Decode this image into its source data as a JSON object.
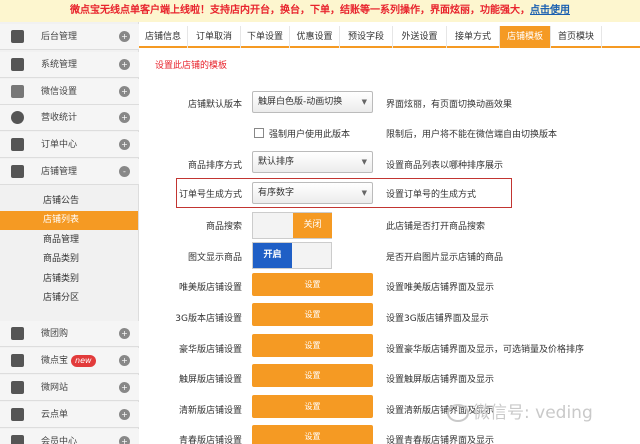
{
  "banner": {
    "text": "微点宝无线点单客户端上线啦！支持店内开台，换台，下单，结账等一系列操作，界面炫丽，功能强大，",
    "link": "点击使用"
  },
  "sidebar": {
    "items": [
      {
        "label": "后台管理",
        "toggle": "+"
      },
      {
        "label": "系统管理",
        "toggle": "+"
      },
      {
        "label": "微信设置",
        "toggle": "+"
      },
      {
        "label": "营收统计",
        "toggle": "+"
      },
      {
        "label": "订单中心",
        "toggle": "+"
      },
      {
        "label": "店铺管理",
        "toggle": "-"
      }
    ],
    "subitems": [
      "店铺公告",
      "店铺列表",
      "商品管理",
      "商品类别",
      "店铺类别",
      "店铺分区"
    ],
    "items2": [
      {
        "label": "微团购",
        "toggle": "+"
      },
      {
        "label": "微点宝",
        "toggle": "+",
        "badge": "new"
      },
      {
        "label": "微网站",
        "toggle": "+"
      },
      {
        "label": "云点单",
        "toggle": "+"
      },
      {
        "label": "会员中心",
        "toggle": "+"
      }
    ]
  },
  "tabs": [
    "店铺信息",
    "订单取消",
    "下单设置",
    "优惠设置",
    "预设字段",
    "外送设置",
    "接单方式",
    "店铺模板",
    "首页模块"
  ],
  "active_tab": "店铺模板",
  "content": {
    "section_title": "设置此店铺的模板",
    "rows": [
      {
        "label": "店铺默认版本",
        "control": "触屏白色版-动画切换",
        "desc": "界面炫丽，有页面切换动画效果"
      },
      {
        "label": "",
        "checkbox": "强制用户使用此版本",
        "desc": "限制后，用户将不能在微信端自由切换版本"
      },
      {
        "label": "商品排序方式",
        "control": "默认排序",
        "desc": "设置商品列表以哪种排序展示"
      },
      {
        "label": "订单号生成方式",
        "control": "有序数字",
        "desc": "设置订单号的生成方式"
      },
      {
        "label": "商品搜索",
        "toggle_off": "关闭",
        "desc": "此店铺是否打开商品搜索"
      },
      {
        "label": "图文显示商品",
        "toggle_on": "开启",
        "desc": "是否开启图片显示店铺的商品"
      },
      {
        "label": "唯美版店铺设置",
        "button": "设置",
        "desc": "设置唯美版店铺界面及显示"
      },
      {
        "label": "3G版本店铺设置",
        "button": "设置",
        "desc": "设置3G版店铺界面及显示"
      },
      {
        "label": "豪华版店铺设置",
        "button": "设置",
        "desc": "设置豪华版店铺界面及显示，可选销量及价格排序"
      },
      {
        "label": "触屏版店铺设置",
        "button": "设置",
        "desc": "设置触屏版店铺界面及显示"
      },
      {
        "label": "清新版店铺设置",
        "button": "设置",
        "desc": "设置清新版店铺界面及显示"
      },
      {
        "label": "青春版店铺设置",
        "button": "设置",
        "desc": "设置青春版店铺界面及显示"
      }
    ]
  },
  "watermark": "微信号: veding",
  "colors": {
    "accent": "#f59a23",
    "highlight_border": "#c23531",
    "banner_text": "#e8242d",
    "toggle_on": "#1f5fc6"
  }
}
